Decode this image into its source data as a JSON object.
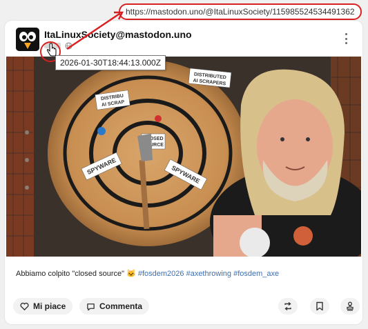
{
  "address_bar": {
    "url": "https://mastodon.uno/@ItaLinuxSociety/115985524534491362"
  },
  "post": {
    "author": "ItaLinuxSociety@mastodon.uno",
    "timestamp_tooltip": "2026-01-30T18:44:13.000Z",
    "text_prefix": "Abbiamo colpito \"closed source\"",
    "emoji": "🐱",
    "hashtags": [
      "#fosdem2026",
      "#axethrowing",
      "#fosdem_axe"
    ],
    "image_labels": {
      "sign1": "DISTRIBUTED",
      "sign1b": "AI SCRAPERS",
      "sign2": "DISTRIBU",
      "sign2b": "AI SCRAP",
      "sign3": "CLOSED",
      "sign3b": "SOURCE",
      "sign4": "SPYWARE",
      "sign5": "SPYWARE"
    }
  },
  "actions": {
    "like_label": "Mi piace",
    "comment_label": "Commenta"
  },
  "colors": {
    "highlight": "#d92020",
    "hashtag": "#3b6fb6"
  }
}
